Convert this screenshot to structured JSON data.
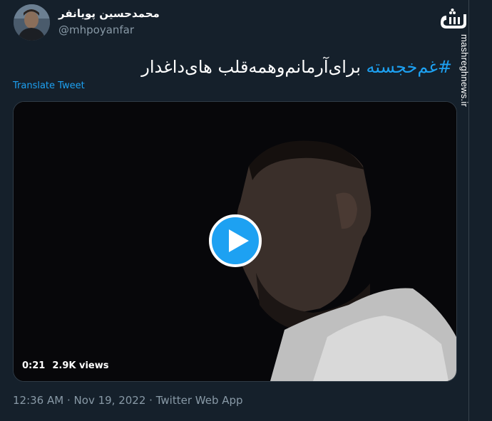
{
  "author": {
    "display_name": "محمدحسین پویانفر",
    "handle": "@mhpoyanfar"
  },
  "tweet": {
    "hashtag": "#غم‌خجسته",
    "text": "برای‌آرمانم‌وهمه‌قلب های‌داغدار"
  },
  "translate_label": "Translate Tweet",
  "video": {
    "duration": "0:21",
    "views": "2.9K views"
  },
  "meta": {
    "time": "12:36 AM",
    "date": "Nov 19, 2022",
    "source": "Twitter Web App",
    "separator": "·"
  },
  "watermark": {
    "logo_text": "مشرق",
    "site": "mashreghnews.ir"
  },
  "colors": {
    "background": "#15202b",
    "accent": "#1da1f2",
    "secondary_text": "#8899a6"
  }
}
